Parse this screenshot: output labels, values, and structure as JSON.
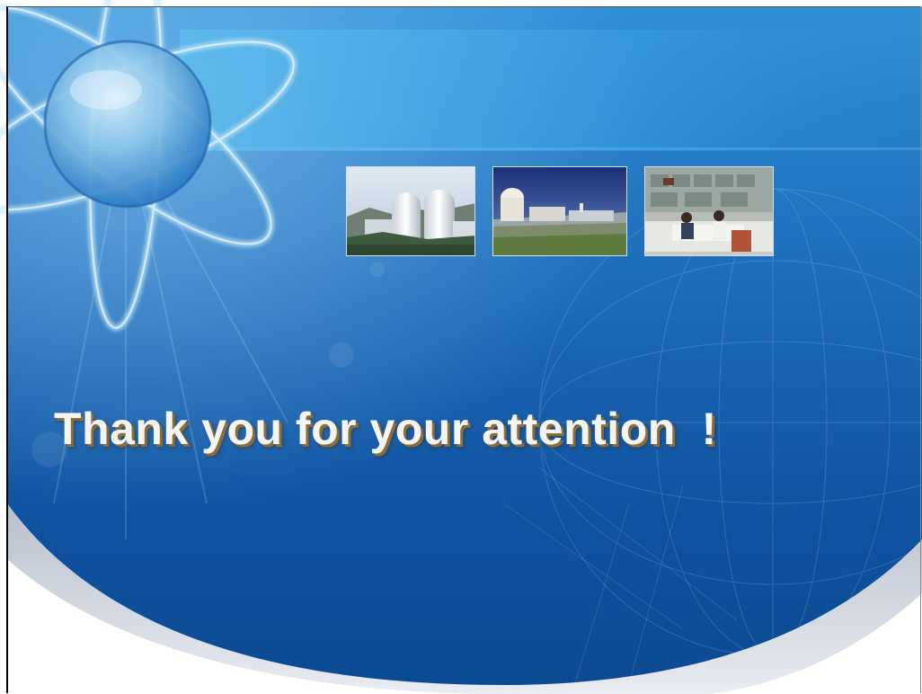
{
  "slide": {
    "message": "Thank you for your attention  !",
    "colors": {
      "background_top": "#2f8fd6",
      "background_bottom": "#0b4a91",
      "message_text": "#f4f4f4",
      "message_shadow": "#8a6d3b",
      "lower_sweep": "#c9ced8"
    },
    "photos": [
      {
        "subject": "containment-domes-photo"
      },
      {
        "subject": "reactor-site-photo"
      },
      {
        "subject": "control-room-photo"
      }
    ],
    "decorations": [
      "atom-orbit-icon",
      "globe-grid-icon"
    ]
  }
}
